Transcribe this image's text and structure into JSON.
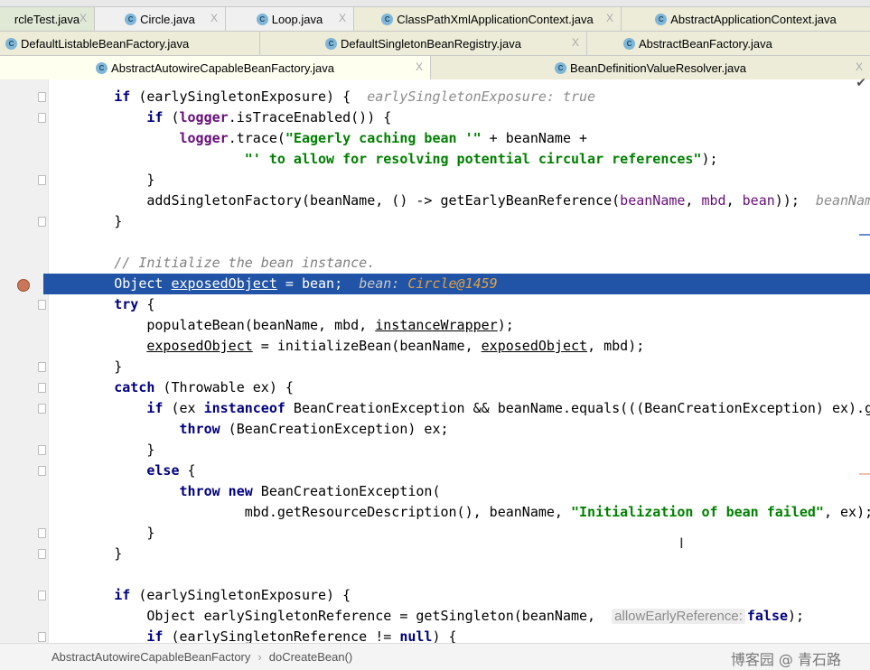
{
  "tabs": {
    "row1": [
      {
        "label": "rcleTest.java"
      },
      {
        "label": "Circle.java"
      },
      {
        "label": "Loop.java"
      },
      {
        "label": "ClassPathXmlApplicationContext.java"
      },
      {
        "label": "AbstractApplicationContext.java"
      }
    ],
    "row2": [
      {
        "label": "DefaultListableBeanFactory.java"
      },
      {
        "label": "DefaultSingletonBeanRegistry.java"
      },
      {
        "label": "AbstractBeanFactory.java"
      }
    ],
    "row3": [
      {
        "label": "AbstractAutowireCapableBeanFactory.java",
        "active": true
      },
      {
        "label": "BeanDefinitionValueResolver.java"
      }
    ],
    "close_glyph": "X",
    "class_icon": "C"
  },
  "editor": {
    "current_line_color": "#2154a6",
    "lines": [
      {
        "indent": 8,
        "t": [
          [
            "kw",
            "if"
          ],
          [
            "p",
            " (earlySingletonExposure) {  "
          ],
          [
            "hint",
            "earlySingletonExposure: true"
          ]
        ]
      },
      {
        "indent": 12,
        "t": [
          [
            "kw",
            "if"
          ],
          [
            "p",
            " ("
          ],
          [
            "fld",
            "logger"
          ],
          [
            "p",
            ".isTraceEnabled()) {"
          ]
        ]
      },
      {
        "indent": 16,
        "t": [
          [
            "fld",
            "logger"
          ],
          [
            "p",
            ".trace("
          ],
          [
            "str",
            "\"Eagerly caching bean '\""
          ],
          [
            "p",
            " + beanName +"
          ]
        ]
      },
      {
        "indent": 24,
        "t": [
          [
            "str",
            "\"' to allow for resolving potential circular references\""
          ],
          [
            "p",
            ");"
          ]
        ]
      },
      {
        "indent": 12,
        "t": [
          [
            "p",
            "}"
          ]
        ]
      },
      {
        "indent": 12,
        "t": [
          [
            "p",
            "addSingletonFactory(beanName, () -> getEarlyBeanReference("
          ],
          [
            "pur",
            "beanName"
          ],
          [
            "p",
            ", "
          ],
          [
            "pur",
            "mbd"
          ],
          [
            "p",
            ", "
          ],
          [
            "pur",
            "bean"
          ],
          [
            "p",
            "));  "
          ],
          [
            "hint",
            "beanNam"
          ]
        ]
      },
      {
        "indent": 8,
        "t": [
          [
            "p",
            "}"
          ]
        ]
      },
      {
        "indent": 0,
        "t": []
      },
      {
        "indent": 8,
        "t": [
          [
            "cm",
            "// Initialize the bean instance."
          ]
        ]
      },
      {
        "indent": 8,
        "current": true,
        "t": [
          [
            "p",
            "Object "
          ],
          [
            "ul",
            "exposedObject"
          ],
          [
            "p",
            " = bean;  "
          ],
          [
            "hint",
            "bean: "
          ],
          [
            "hintv",
            "Circle@1459"
          ]
        ]
      },
      {
        "indent": 8,
        "t": [
          [
            "kw",
            "try"
          ],
          [
            "p",
            " {"
          ]
        ]
      },
      {
        "indent": 12,
        "t": [
          [
            "p",
            "populateBean(beanName, mbd, "
          ],
          [
            "ul",
            "instanceWrapper"
          ],
          [
            "p",
            ");"
          ]
        ]
      },
      {
        "indent": 12,
        "t": [
          [
            "ul",
            "exposedObject"
          ],
          [
            "p",
            " = initializeBean(beanName, "
          ],
          [
            "ul",
            "exposedObject"
          ],
          [
            "p",
            ", mbd);"
          ]
        ]
      },
      {
        "indent": 8,
        "t": [
          [
            "p",
            "}"
          ]
        ]
      },
      {
        "indent": 8,
        "t": [
          [
            "kw",
            "catch"
          ],
          [
            "p",
            " (Throwable ex) {"
          ]
        ]
      },
      {
        "indent": 12,
        "t": [
          [
            "kw",
            "if"
          ],
          [
            "p",
            " (ex "
          ],
          [
            "kw",
            "instanceof"
          ],
          [
            "p",
            " BeanCreationException && beanName.equals(((BeanCreationException) ex).g"
          ]
        ]
      },
      {
        "indent": 16,
        "t": [
          [
            "kw",
            "throw"
          ],
          [
            "p",
            " (BeanCreationException) ex;"
          ]
        ]
      },
      {
        "indent": 12,
        "t": [
          [
            "p",
            "}"
          ]
        ]
      },
      {
        "indent": 12,
        "t": [
          [
            "kw",
            "else"
          ],
          [
            "p",
            " {"
          ]
        ]
      },
      {
        "indent": 16,
        "t": [
          [
            "kw",
            "throw new"
          ],
          [
            "p",
            " BeanCreationException("
          ]
        ]
      },
      {
        "indent": 24,
        "t": [
          [
            "p",
            "mbd.getResourceDescription(), beanName, "
          ],
          [
            "str",
            "\"Initialization of bean failed\""
          ],
          [
            "p",
            ", ex);"
          ]
        ]
      },
      {
        "indent": 12,
        "t": [
          [
            "p",
            "}"
          ]
        ]
      },
      {
        "indent": 8,
        "t": [
          [
            "p",
            "}"
          ]
        ]
      },
      {
        "indent": 0,
        "t": []
      },
      {
        "indent": 8,
        "t": [
          [
            "kw",
            "if"
          ],
          [
            "p",
            " (earlySingletonExposure) {"
          ]
        ]
      },
      {
        "indent": 12,
        "t": [
          [
            "p",
            "Object earlySingletonReference = getSingleton(beanName,  "
          ],
          [
            "inlay",
            "allowEarlyReference:"
          ],
          [
            "kw",
            "false"
          ],
          [
            "p",
            ");"
          ]
        ]
      },
      {
        "indent": 12,
        "t": [
          [
            "kw",
            "if"
          ],
          [
            "p",
            " (earlySingletonReference != "
          ],
          [
            "kw",
            "null"
          ],
          [
            "p",
            ") {"
          ]
        ]
      }
    ]
  },
  "breadcrumb": {
    "class_name": "AbstractAutowireCapableBeanFactory",
    "separator": "›",
    "method": "doCreateBean()"
  },
  "watermark": "博客园 @ 青石路"
}
